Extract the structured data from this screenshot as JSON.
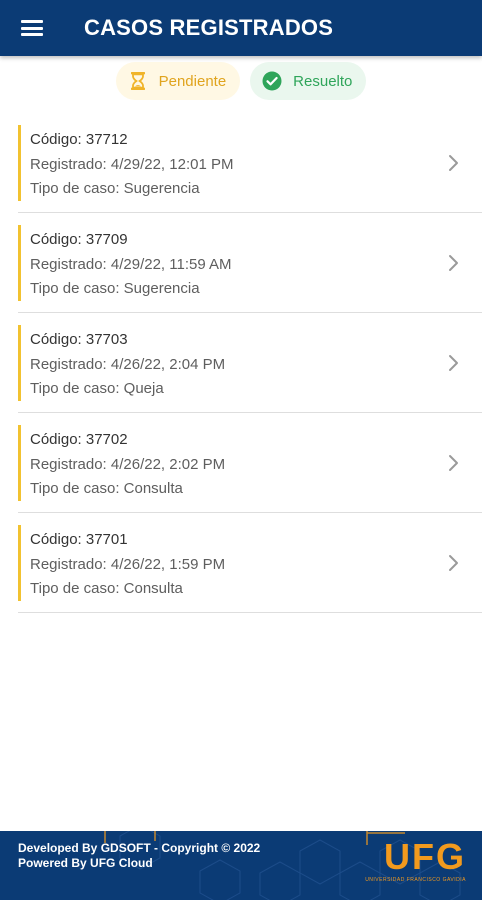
{
  "header": {
    "title": "CASOS REGISTRADOS",
    "menu_icon": "hamburger-menu-icon",
    "background": "#0b3b75"
  },
  "filters": [
    {
      "label": "Pendiente",
      "icon": "hourglass-icon",
      "color": "#e0a41e"
    },
    {
      "label": "Resuelto",
      "icon": "check-circle-icon",
      "color": "#2fa55a"
    }
  ],
  "cases": [
    {
      "code": "Código: 37712",
      "registered": "Registrado: 4/29/22, 12:01 PM",
      "type": "Tipo de caso: Sugerencia"
    },
    {
      "code": "Código: 37709",
      "registered": "Registrado: 4/29/22, 11:59 AM",
      "type": "Tipo de caso: Sugerencia"
    },
    {
      "code": "Código: 37703",
      "registered": "Registrado: 4/26/22, 2:04 PM",
      "type": "Tipo de caso: Queja"
    },
    {
      "code": "Código: 37702",
      "registered": "Registrado: 4/26/22, 2:02 PM",
      "type": "Tipo de caso: Consulta"
    },
    {
      "code": "Código: 37701",
      "registered": "Registrado: 4/26/22, 1:59 PM",
      "type": "Tipo de caso: Consulta"
    }
  ],
  "case_accent_color": "#f2c230",
  "footer": {
    "line1": "Developed By GDSOFT - Copyright © 2022",
    "line2": "Powered By UFG Cloud",
    "logo_text": "UFG",
    "logo_subtitle": "UNIVERSIDAD FRANCISCO GAVIDIA",
    "logo_color": "#f29a1e"
  }
}
